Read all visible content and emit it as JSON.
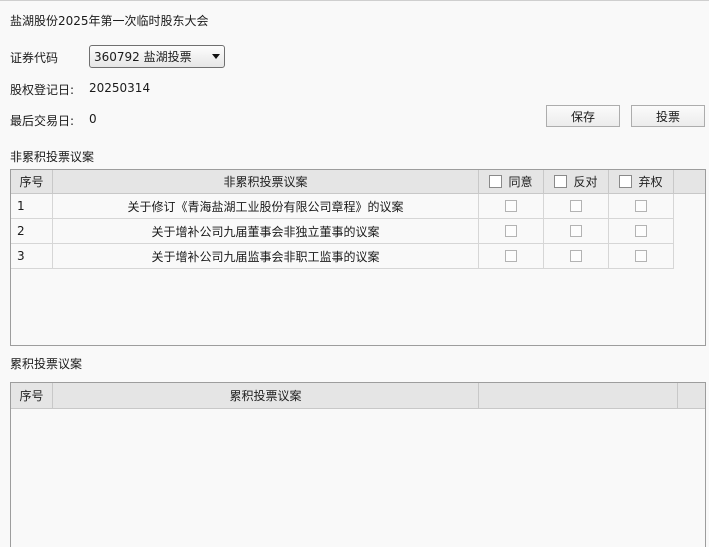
{
  "title": "盐湖股份2025年第一次临时股东大会",
  "fields": {
    "code_label": "证券代码",
    "code_value": "360792 盐湖投票",
    "record_date_label": "股权登记日:",
    "record_date_value": "20250314",
    "last_trade_label": "最后交易日:",
    "last_trade_value": "0"
  },
  "buttons": {
    "save": "保存",
    "vote": "投票"
  },
  "non_cumulative": {
    "section_title": "非累积投票议案",
    "columns": {
      "seq": "序号",
      "proposal": "非累积投票议案",
      "agree": "同意",
      "oppose": "反对",
      "abstain": "弃权"
    },
    "rows": [
      {
        "seq": "1",
        "proposal": "关于修订《青海盐湖工业股份有限公司章程》的议案"
      },
      {
        "seq": "2",
        "proposal": "关于增补公司九届董事会非独立董事的议案"
      },
      {
        "seq": "3",
        "proposal": "关于增补公司九届监事会非职工监事的议案"
      }
    ]
  },
  "cumulative": {
    "section_title": "累积投票议案",
    "columns": {
      "seq": "序号",
      "proposal": "累积投票议案"
    }
  }
}
